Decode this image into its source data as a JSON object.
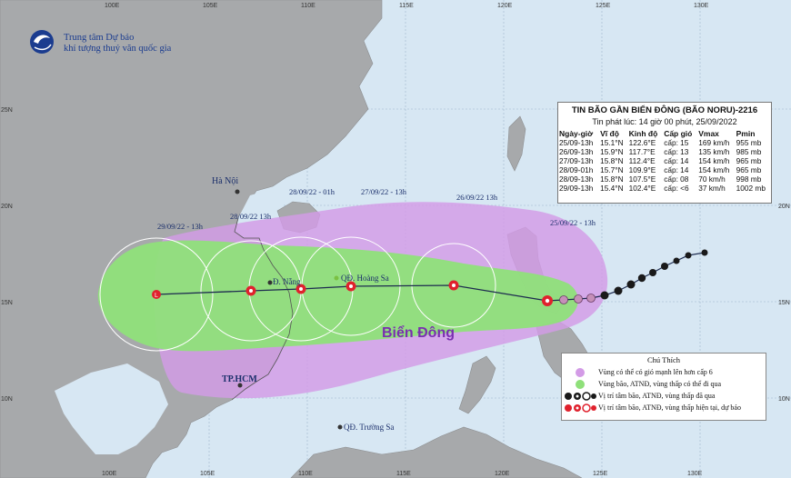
{
  "header": {
    "org_line1": "Trung tâm Dự báo",
    "org_line2": "khí tượng thuỷ văn quốc gia"
  },
  "bulletin": {
    "title": "TIN BÃO GẦN BIỂN ĐÔNG (BÃO NORU)-2216",
    "issued": "Tin phát lúc: 14 giờ 00 phút, 25/09/2022",
    "columns": [
      "Ngày-giờ",
      "Vĩ độ",
      "Kinh độ",
      "Cấp gió",
      "Vmax",
      "Pmin"
    ],
    "rows": [
      [
        "25/09-13h",
        "15.1°N",
        "122.6°E",
        "cấp: 15",
        "169 km/h",
        "955 mb"
      ],
      [
        "26/09-13h",
        "15.9°N",
        "117.7°E",
        "cấp: 13",
        "135 km/h",
        "985 mb"
      ],
      [
        "27/09-13h",
        "15.8°N",
        "112.4°E",
        "cấp: 14",
        "154 km/h",
        "965 mb"
      ],
      [
        "28/09-01h",
        "15.7°N",
        "109.9°E",
        "cấp: 14",
        "154 km/h",
        "965 mb"
      ],
      [
        "28/09-13h",
        "15.8°N",
        "107.5°E",
        "cấp: 08",
        "70 km/h",
        "998 mb"
      ],
      [
        "29/09-13h",
        "15.4°N",
        "102.4°E",
        "cấp: <6",
        "37 km/h",
        "1002 mb"
      ]
    ]
  },
  "map_labels": {
    "ha_noi": "Hà Nội",
    "da_nang": "Đ. Nẵng",
    "hoang_sa": "QĐ. Hoàng Sa",
    "bien_dong": "Biển Đông",
    "tp_hcm": "TP.HCM",
    "truong_sa": "QĐ. Trường Sa"
  },
  "track_labels": {
    "d29": "29/09/22 - 13h",
    "d28_13": "28/09/22  13h",
    "d28_01": "28/09/22 - 01h",
    "d27": "27/09/22 - 13h",
    "d26": "26/09/22  13h",
    "d25": "25/09/22 - 13h"
  },
  "axes": {
    "lon_top": [
      "100E",
      "105E",
      "110E",
      "115E",
      "120E",
      "125E",
      "130E"
    ],
    "lon_bottom": [
      "100E",
      "105E",
      "110E",
      "115E",
      "120E",
      "125E",
      "130E"
    ],
    "lat": [
      "25N",
      "20N",
      "15N",
      "10N"
    ]
  },
  "legend": {
    "title": "Chú Thích",
    "items": [
      "Vùng có thể có gió mạnh lên hơn cấp 6",
      "Vùng bão, ATNĐ, vùng thấp có thể đi qua",
      "Vị trí tâm bão, ATNĐ, vùng thấp đã qua",
      "Vị trí tâm bão, ATNĐ, vùng thấp hiện tại, dự báo"
    ]
  },
  "colors": {
    "sea": "#d7e7f3",
    "land": "#a7a9ab",
    "danger_zone": "#d39be6",
    "storm_zone": "#8fe07a",
    "forecast_symbol": "#e0212d",
    "past_symbol": "#1a1a1a",
    "track_line": "#1d2b4f"
  }
}
